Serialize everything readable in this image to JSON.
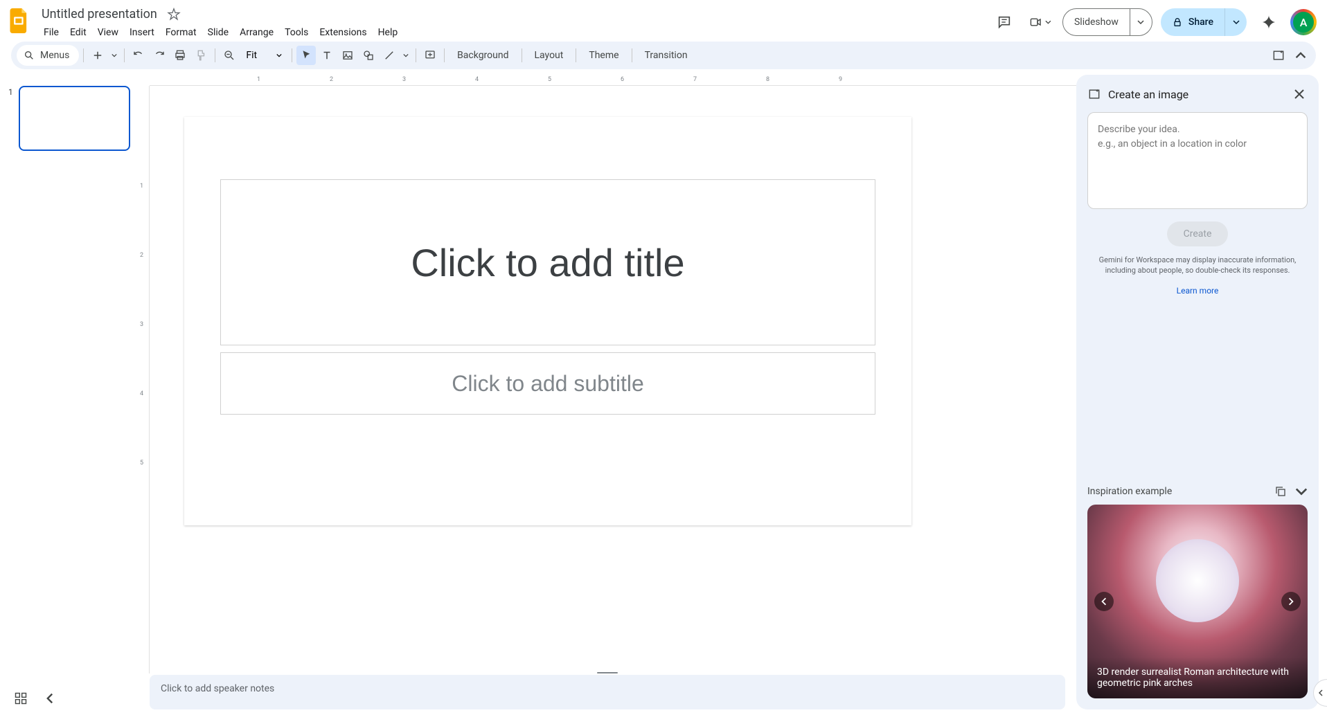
{
  "header": {
    "doc_title": "Untitled presentation",
    "menus": [
      "File",
      "Edit",
      "View",
      "Insert",
      "Format",
      "Slide",
      "Arrange",
      "Tools",
      "Extensions",
      "Help"
    ],
    "slideshow_label": "Slideshow",
    "share_label": "Share",
    "avatar_letter": "A"
  },
  "toolbar": {
    "menus_label": "Menus",
    "zoom_label": "Fit",
    "background_label": "Background",
    "layout_label": "Layout",
    "theme_label": "Theme",
    "transition_label": "Transition"
  },
  "filmstrip": {
    "slides": [
      {
        "number": "1"
      }
    ]
  },
  "ruler_h": [
    "1",
    "2",
    "3",
    "4",
    "5",
    "6",
    "7",
    "8",
    "9"
  ],
  "ruler_v": [
    "1",
    "2",
    "3",
    "4",
    "5"
  ],
  "slide": {
    "title_placeholder": "Click to add title",
    "subtitle_placeholder": "Click to add subtitle"
  },
  "notes": {
    "placeholder": "Click to add speaker notes"
  },
  "side_panel": {
    "title": "Create an image",
    "textarea_placeholder": "Describe your idea.\ne.g., an object in a location in color",
    "create_label": "Create",
    "disclaimer": "Gemini for Workspace may display inaccurate information, including about people, so double-check its responses.",
    "learn_more": "Learn more",
    "inspiration_title": "Inspiration example",
    "inspiration_caption": "3D render surrealist Roman architecture with geometric pink arches"
  }
}
